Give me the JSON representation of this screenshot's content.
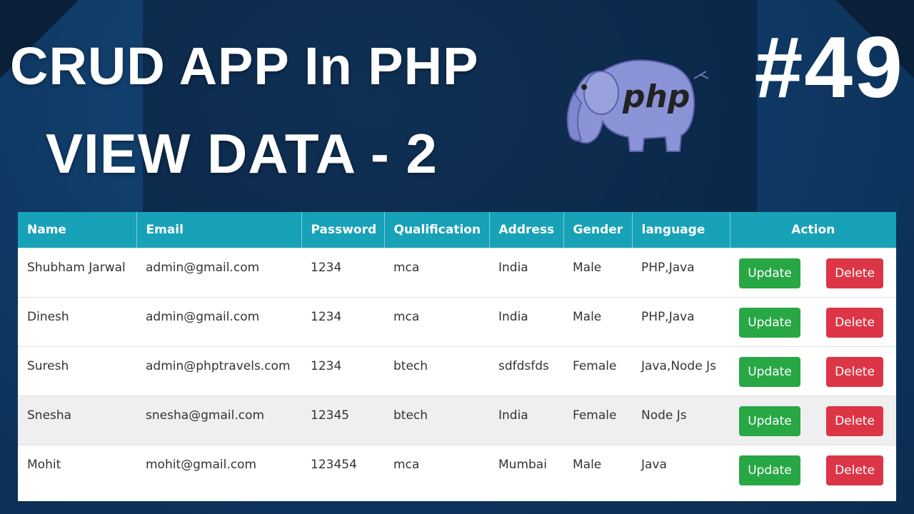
{
  "banner": {
    "line1": "CRUD APP In PHP",
    "line2": "VIEW DATA - 2",
    "episode": "#49",
    "logo_text": "php"
  },
  "table": {
    "headers": [
      "Name",
      "Email",
      "Password",
      "Qualification",
      "Address",
      "Gender",
      "language",
      "Action"
    ],
    "rows": [
      {
        "name": "Shubham Jarwal",
        "email": "admin@gmail.com",
        "password": "1234",
        "qualification": "mca",
        "address": "India",
        "gender": "Male",
        "language": "PHP,Java",
        "update": "Update",
        "delete": "Delete"
      },
      {
        "name": "Dinesh",
        "email": "admin@gmail.com",
        "password": "1234",
        "qualification": "mca",
        "address": "India",
        "gender": "Male",
        "language": "PHP,Java",
        "update": "Update",
        "delete": "Delete"
      },
      {
        "name": "Suresh",
        "email": "admin@phptravels.com",
        "password": "1234",
        "qualification": "btech",
        "address": "sdfdsfds",
        "gender": "Female",
        "language": "Java,Node Js",
        "update": "Update",
        "delete": "Delete"
      },
      {
        "name": "Snesha",
        "email": "snesha@gmail.com",
        "password": "12345",
        "qualification": "btech",
        "address": "India",
        "gender": "Female",
        "language": "Node Js",
        "update": "Update",
        "delete": "Delete"
      },
      {
        "name": "Mohit",
        "email": "mohit@gmail.com",
        "password": "123454",
        "qualification": "mca",
        "address": "Mumbai",
        "gender": "Male",
        "language": "Java",
        "update": "Update",
        "delete": "Delete"
      }
    ]
  },
  "colors": {
    "header_bg": "#17a2b8",
    "update_btn": "#28a745",
    "delete_btn": "#dc3545",
    "background": "#0f3a66"
  },
  "icons": [
    "php-elephant-icon"
  ]
}
